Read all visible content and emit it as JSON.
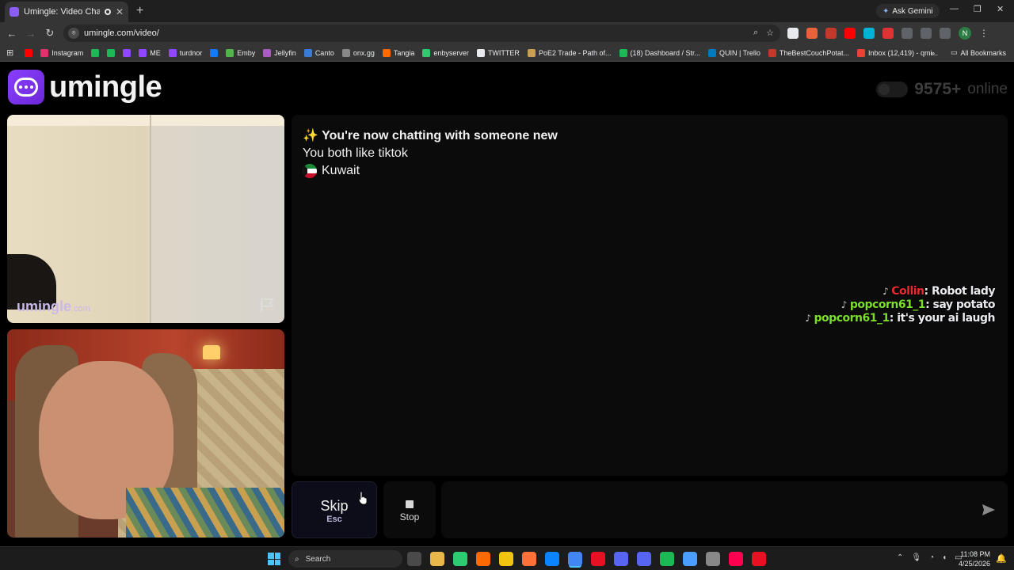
{
  "browser": {
    "tab_title": "Umingle: Video Chat with S",
    "ask_gemini": "Ask Gemini",
    "url": "umingle.com/video/",
    "bookmarks": [
      {
        "label": "",
        "color": "#ff0000"
      },
      {
        "label": "Instagram",
        "color": "#e1306c"
      },
      {
        "label": "",
        "color": "#1db954"
      },
      {
        "label": "",
        "color": "#1db954"
      },
      {
        "label": "",
        "color": "#9146ff"
      },
      {
        "label": "ME",
        "color": "#9146ff"
      },
      {
        "label": "turdnor",
        "color": "#9146ff"
      },
      {
        "label": "",
        "color": "#1877f2"
      },
      {
        "label": "Emby",
        "color": "#52b54b"
      },
      {
        "label": "Jellyfin",
        "color": "#aa5cc3"
      },
      {
        "label": "Canto",
        "color": "#3a7bd5"
      },
      {
        "label": "onx.gg",
        "color": "#888888"
      },
      {
        "label": "Tangia",
        "color": "#ff6a00"
      },
      {
        "label": "enbyserver",
        "color": "#2ecc71"
      },
      {
        "label": "TWITTER",
        "color": "#e8eaed"
      },
      {
        "label": "PoE2 Trade - Path of...",
        "color": "#c8a050"
      },
      {
        "label": "(18) Dashboard / Str...",
        "color": "#1db954"
      },
      {
        "label": "QUIN | Trello",
        "color": "#0079bf"
      },
      {
        "label": "TheBestCouchPotat...",
        "color": "#c0392b"
      },
      {
        "label": "Inbox (12,419) - qmi...",
        "color": "#ea4335"
      }
    ],
    "all_bookmarks": "All Bookmarks"
  },
  "site": {
    "logo_text": "umingle",
    "online_count": "9575+",
    "online_label": "online"
  },
  "video": {
    "watermark_main": "umingle",
    "watermark_suffix": ".com"
  },
  "chat": {
    "headline_emoji": "✨",
    "headline": "You're now chatting with someone new",
    "interest": "You both like tiktok",
    "country": "Kuwait"
  },
  "overlay": {
    "lines": [
      {
        "user": "Collin",
        "user_color": "#e82c2c",
        "text": "Robot lady"
      },
      {
        "user": "popcorn61_1",
        "user_color": "#7be02a",
        "text": "say potato"
      },
      {
        "user": "popcorn61_1",
        "user_color": "#7be02a",
        "text": "it's your ai laugh"
      }
    ]
  },
  "controls": {
    "skip_label": "Skip",
    "skip_key": "Esc",
    "stop_label": "Stop",
    "message_placeholder": ""
  },
  "taskbar": {
    "search_label": "Search",
    "time": "11:08 PM",
    "date": "4/25/2026",
    "apps": [
      "#4a4a4a",
      "#e8b84a",
      "#2ecc71",
      "#ff6a00",
      "#f1c40f",
      "#ff7139",
      "#0a84ff",
      "#4285f4",
      "#e81123",
      "#5865f2",
      "#5865f2",
      "#1db954",
      "#4a9eff",
      "#888888",
      "#ff0050",
      "#e81123"
    ]
  }
}
